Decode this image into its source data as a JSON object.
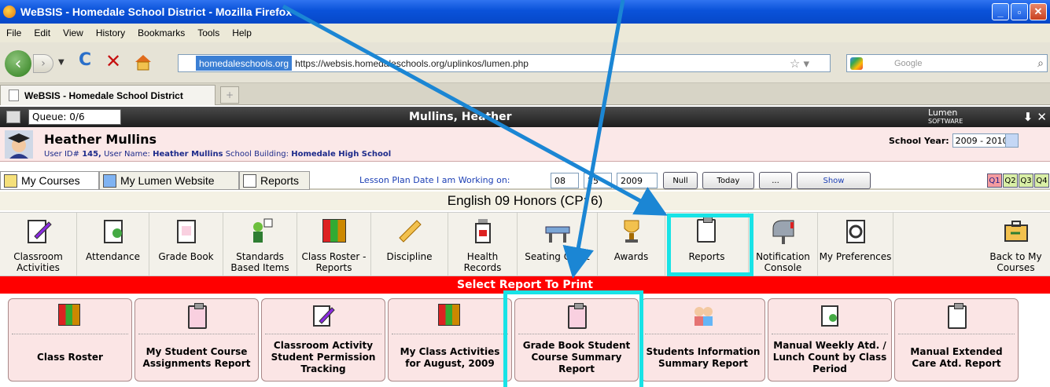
{
  "window": {
    "title": "WeBSIS - Homedale School District - Mozilla Firefox"
  },
  "menu": [
    "File",
    "Edit",
    "View",
    "History",
    "Bookmarks",
    "Tools",
    "Help"
  ],
  "url": {
    "site_badge": "homedaleschools.org",
    "address": "https://websis.homedaleschools.org/uplinkos/lumen.php"
  },
  "search": {
    "placeholder": "Google"
  },
  "browser_tab": {
    "title": "WeBSIS - Homedale School District"
  },
  "lumen_bar": {
    "queue": "Queue: 0/6",
    "user": "Mullins, Heather",
    "logo": "Lumen",
    "logo_sub": "SOFTWARE"
  },
  "user": {
    "full_name": "Heather Mullins",
    "id_label": "User ID#",
    "id": "145,",
    "username_label": "User Name:",
    "username": "Heather Mullins",
    "building_label": "School Building:",
    "building": "Homedale High School",
    "school_year_label": "School Year:",
    "school_year": "2009 - 2010"
  },
  "main_tabs": [
    "My Courses",
    "My Lumen Website",
    "Reports"
  ],
  "lesson": {
    "label": "Lesson Plan Date I am Working on:",
    "month": "08",
    "day": "25",
    "year": "2009",
    "buttons": [
      "Null",
      "Today",
      "...",
      "Show"
    ]
  },
  "quarters": [
    "Q1",
    "Q2",
    "Q3",
    "Q4"
  ],
  "course_title": "English 09 Honors (CP: 6)",
  "tools": [
    {
      "label": "Classroom Activities",
      "icon": "pencil-pad-icon"
    },
    {
      "label": "Attendance",
      "icon": "attendance-clipboard-icon"
    },
    {
      "label": "Grade Book",
      "icon": "gradebook-clipboard-icon"
    },
    {
      "label": "Standards Based Items",
      "icon": "standards-people-icon"
    },
    {
      "label": "Class Roster - Reports",
      "icon": "books-icon"
    },
    {
      "label": "Discipline",
      "icon": "ruler-icon"
    },
    {
      "label": "Health Records",
      "icon": "medicine-bottle-icon"
    },
    {
      "label": "Seating Chart",
      "icon": "desk-icon"
    },
    {
      "label": "Awards",
      "icon": "trophy-icon"
    },
    {
      "label": "Reports",
      "icon": "report-clipboard-icon"
    },
    {
      "label": "Notification Console",
      "icon": "mailbox-icon"
    },
    {
      "label": "My Preferences",
      "icon": "preferences-clipboard-icon"
    },
    {
      "label": "Back to My Courses",
      "icon": "briefcase-icon"
    }
  ],
  "select_report_banner": "Select Report To Print",
  "reports": [
    {
      "label": "Class Roster",
      "icon": "books-icon"
    },
    {
      "label": "My Student Course Assignments Report",
      "icon": "gradebook-clipboard-icon"
    },
    {
      "label": "Classroom Activity Student Permission Tracking",
      "icon": "pencil-pad-icon"
    },
    {
      "label": "My Class Activities for August, 2009",
      "icon": "books-icon"
    },
    {
      "label": "Grade Book Student Course Summary Report",
      "icon": "gradebook-clipboard-icon"
    },
    {
      "label": "Students Information Summary Report",
      "icon": "students-icon"
    },
    {
      "label": "Manual Weekly Atd. / Lunch Count by Class Period",
      "icon": "attendance-clipboard-icon"
    },
    {
      "label": "Manual Extended Care Atd. Report",
      "icon": "report-clipboard-icon"
    }
  ],
  "colors": {
    "highlight": "#18e3e6",
    "banner": "#ff0000",
    "arrow": "#1b86d4"
  }
}
